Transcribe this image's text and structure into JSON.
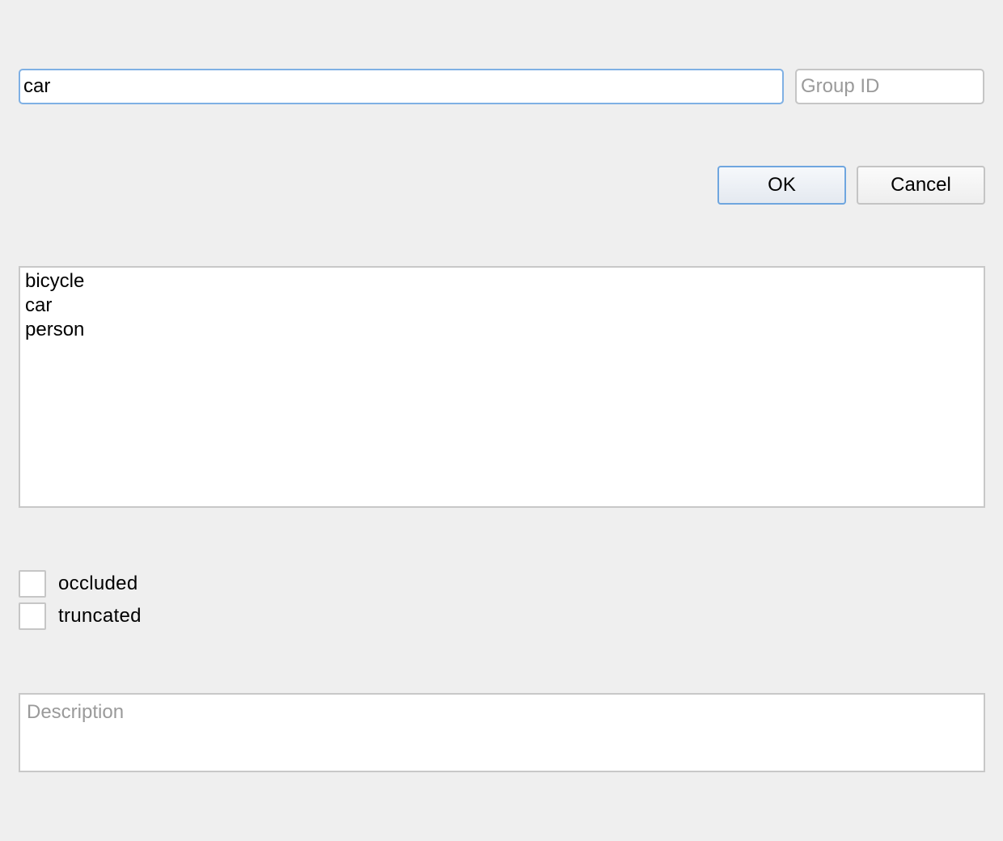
{
  "label_field": {
    "value": "car",
    "placeholder": ""
  },
  "group_id_field": {
    "value": "",
    "placeholder": "Group ID"
  },
  "buttons": {
    "ok_label": "OK",
    "cancel_label": "Cancel"
  },
  "label_list": {
    "items": [
      "bicycle",
      "car",
      "person"
    ]
  },
  "flags": [
    {
      "label": "occluded",
      "checked": false
    },
    {
      "label": "truncated",
      "checked": false
    }
  ],
  "description_field": {
    "value": "",
    "placeholder": "Description"
  },
  "colors": {
    "background": "#efefef",
    "focus_border": "#7fb0e4",
    "default_button_border": "#6fa6df",
    "field_border": "#c5c5c5",
    "placeholder": "#9a9a9a"
  }
}
